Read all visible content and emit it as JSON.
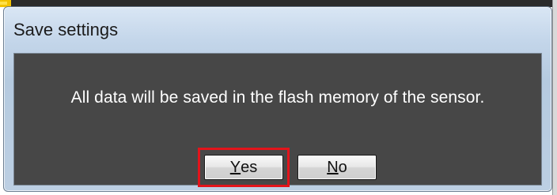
{
  "dialog": {
    "title": "Save settings",
    "message": "All data will be saved in the flash memory of the sensor.",
    "buttons": {
      "yes": {
        "mnemonic": "Y",
        "rest": "es"
      },
      "no": {
        "mnemonic": "N",
        "rest": "o"
      }
    }
  },
  "colors": {
    "panel_background": "#474747",
    "message_text": "#ffffff",
    "highlight": "#e3141b",
    "title_bar": "#c4d6ea"
  }
}
